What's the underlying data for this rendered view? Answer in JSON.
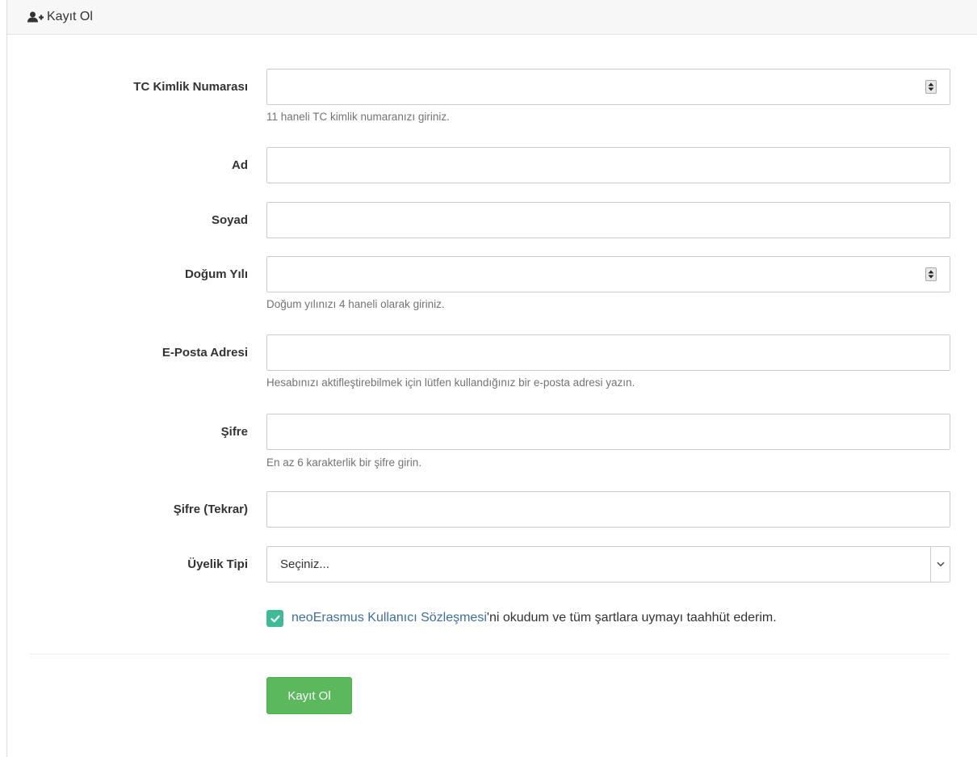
{
  "panel": {
    "title": "Kayıt Ol",
    "title_icon": "user-plus-icon"
  },
  "fields": {
    "tc": {
      "label": "TC Kimlik Numarası",
      "value": "",
      "help": "11 haneli TC kimlik numaranızı giriniz."
    },
    "ad": {
      "label": "Ad",
      "value": ""
    },
    "soyad": {
      "label": "Soyad",
      "value": ""
    },
    "dogum": {
      "label": "Doğum Yılı",
      "value": "",
      "help": "Doğum yılınızı 4 haneli olarak giriniz."
    },
    "eposta": {
      "label": "E-Posta Adresi",
      "value": "",
      "help": "Hesabınızı aktifleştirebilmek için lütfen kullandığınız bir e-posta adresi yazın."
    },
    "sifre": {
      "label": "Şifre",
      "value": "",
      "help": "En az 6 karakterlik bir şifre girin."
    },
    "sifre_tekrar": {
      "label": "Şifre (Tekrar)",
      "value": ""
    },
    "uyelik": {
      "label": "Üyelik Tipi",
      "selected": "Seçiniz..."
    }
  },
  "agreement": {
    "checked": true,
    "link_text": "neoErasmus Kullanıcı Sözleşmesi",
    "suffix": "'ni okudum ve tüm şartlara uymayı taahhüt ederim."
  },
  "submit": {
    "label": "Kayıt Ol"
  },
  "colors": {
    "checkbox": "#3dbb98",
    "button": "#5cb85c",
    "link": "#3c6ea7"
  }
}
